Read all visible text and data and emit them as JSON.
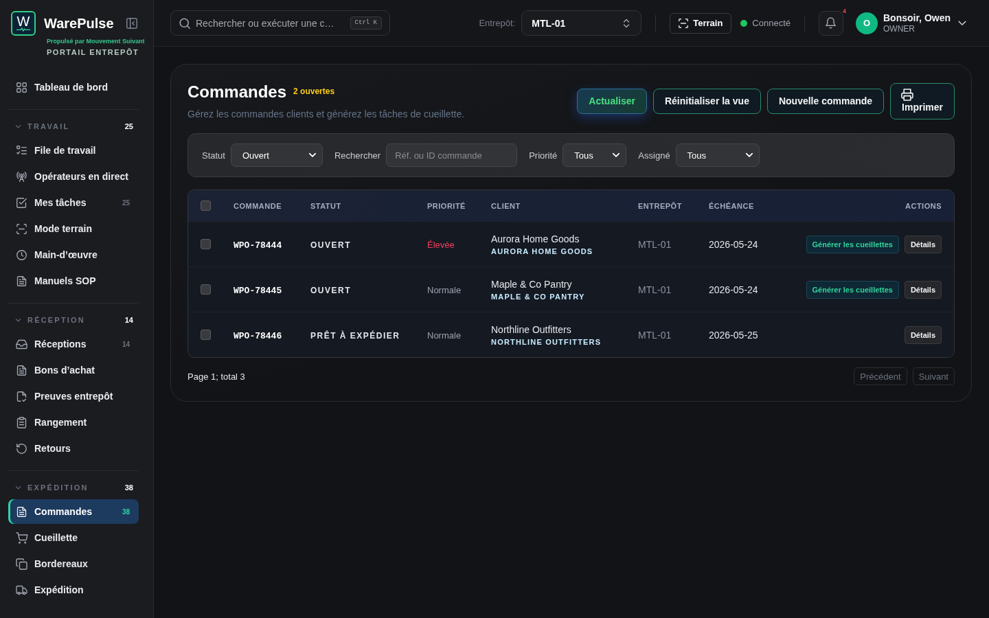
{
  "sidebar": {
    "brand": {
      "logo_letter": "W",
      "name": "WarePulse",
      "tagline": "Propulsé par Mouvement Suivant",
      "subtitle": "PORTAIL ENTREPÔT"
    },
    "top_items": [
      {
        "label": "Tableau de bord",
        "selected": false
      }
    ],
    "sections": [
      {
        "title": "TRAVAIL",
        "count": "25",
        "expanded": true,
        "items": [
          {
            "label": "File de travail",
            "selected": false
          },
          {
            "label": "Opérateurs en direct",
            "selected": false
          },
          {
            "label": "Mes tâches",
            "badge": "25",
            "selected": false
          },
          {
            "label": "Mode terrain",
            "selected": false
          },
          {
            "label": "Main-d’œuvre",
            "selected": false
          },
          {
            "label": "Manuels SOP",
            "selected": false
          }
        ]
      },
      {
        "title": "RÉCEPTION",
        "count": "14",
        "expanded": true,
        "items": [
          {
            "label": "Réceptions",
            "badge": "14",
            "selected": false
          },
          {
            "label": "Bons d’achat",
            "selected": false
          },
          {
            "label": "Preuves entrepôt",
            "selected": false
          },
          {
            "label": "Rangement",
            "selected": false
          },
          {
            "label": "Retours",
            "selected": false
          }
        ]
      },
      {
        "title": "EXPÉDITION",
        "count": "38",
        "expanded": true,
        "items": [
          {
            "label": "Commandes",
            "badge": "38",
            "selected": true
          },
          {
            "label": "Cueillette",
            "selected": false
          },
          {
            "label": "Bordereaux",
            "selected": false
          },
          {
            "label": "Expédition",
            "selected": false
          }
        ]
      }
    ]
  },
  "top_bar": {
    "search": {
      "placeholder": "Rechercher ou exécuter une c…",
      "shortcut": "Ctrl K"
    },
    "warehouse": {
      "label": "Entrepôt:",
      "value": "MTL-01"
    },
    "field_button": {
      "label": "Terrain"
    },
    "connection": {
      "label": "Connecté",
      "online": true
    },
    "notifications": {
      "count": "4"
    },
    "user": {
      "initial": "O",
      "greeting": "Bonsoir, Owen",
      "role": "OWNER"
    }
  },
  "page": {
    "title": "Commandes",
    "open_count": "2 ouvertes",
    "subtitle": "Gérez les commandes clients et générez les tâches de cueillette.",
    "buttons": [
      {
        "label": "Actualiser",
        "kind": "accent"
      },
      {
        "label": "Réinitialiser la vue",
        "kind": "outline"
      },
      {
        "label": "Nouvelle commande",
        "kind": "outline"
      },
      {
        "label": "Imprimer",
        "kind": "print"
      }
    ],
    "filters": [
      {
        "label": "Statut",
        "kind": "select",
        "value": "Ouvert"
      },
      {
        "label": "Rechercher",
        "kind": "input",
        "placeholder": "Réf. ou ID commande"
      },
      {
        "label": "Priorité",
        "kind": "select",
        "value": "Tous"
      },
      {
        "label": "Assigné",
        "kind": "select",
        "value": "Tous"
      }
    ],
    "table": {
      "select_all": {
        "checked": false
      },
      "columns": [
        "COMMANDE",
        "STATUT",
        "PRIORITÉ",
        "CLIENT",
        "ENTREPÔT",
        "ÉCHÉANCE",
        "ACTIONS"
      ],
      "rows": [
        {
          "checked": false,
          "order": "WPO-78444",
          "status": "OUVERT",
          "priority": {
            "label": "Élevée",
            "high": true
          },
          "client": {
            "name": "Aurora Home Goods",
            "code": "AURORA HOME GOODS"
          },
          "warehouse": "MTL-01",
          "due": "2026-05-24",
          "actions": [
            {
              "label": "Générer les cueillettes",
              "kind": "accent"
            },
            {
              "label": "Détails",
              "kind": "plain"
            }
          ]
        },
        {
          "checked": false,
          "order": "WPO-78445",
          "status": "OUVERT",
          "priority": {
            "label": "Normale",
            "high": false
          },
          "client": {
            "name": "Maple & Co Pantry",
            "code": "MAPLE & CO PANTRY"
          },
          "warehouse": "MTL-01",
          "due": "2026-05-24",
          "actions": [
            {
              "label": "Générer les cueillettes",
              "kind": "accent"
            },
            {
              "label": "Détails",
              "kind": "plain"
            }
          ]
        },
        {
          "checked": false,
          "order": "WPO-78446",
          "status": "PRÊT À EXPÉDIER",
          "priority": {
            "label": "Normale",
            "high": false
          },
          "client": {
            "name": "Northline Outfitters",
            "code": "NORTHLINE OUTFITTERS"
          },
          "warehouse": "MTL-01",
          "due": "2026-05-25",
          "actions": [
            {
              "label": "Détails",
              "kind": "plain"
            }
          ]
        }
      ]
    },
    "pagination": {
      "summary": "Page 1; total 3",
      "buttons": [
        {
          "label": "Précédent",
          "disabled": true
        },
        {
          "label": "Suivant",
          "disabled": true
        }
      ]
    }
  }
}
